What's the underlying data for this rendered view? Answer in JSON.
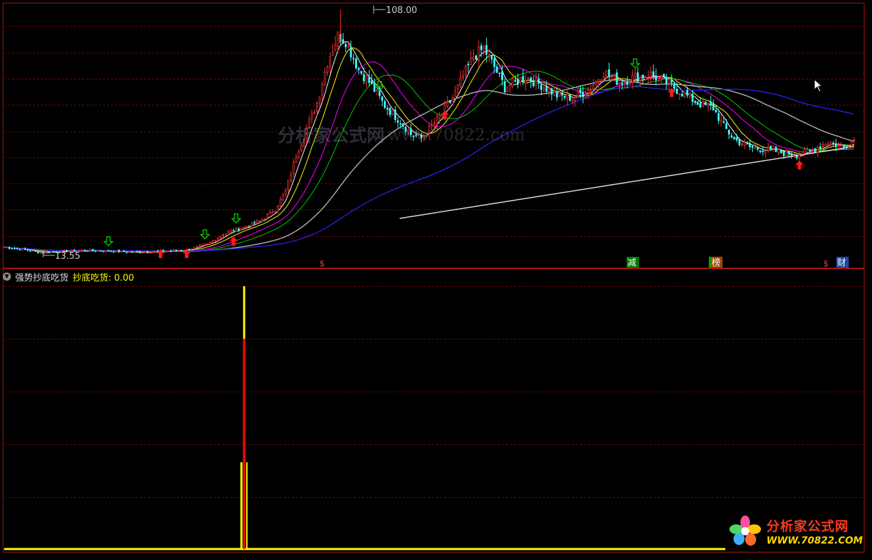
{
  "indicator": {
    "name": "强势抄底吃货",
    "series_label": "抄底吃货:",
    "series_value": "0.00",
    "collapse_icon": "chevron-down-icon"
  },
  "price_panel": {
    "high_label": "108.00",
    "low_label": "13.55",
    "event_markers": [
      "$",
      "减",
      "榜",
      "$",
      "财"
    ]
  },
  "watermarks": {
    "center_cn": "分析家公式网",
    "center_url": "www.70822.com",
    "brand_cn": "分析家公式网",
    "brand_url": "WWW.70822.COM"
  },
  "colors": {
    "background": "#000000",
    "border": "#b01010",
    "grid": "#7a0000",
    "up_candle": "#ff3030",
    "down_candle": "#40ffff",
    "ma5": "#ffffff",
    "ma10": "#ffff00",
    "ma20": "#ff00ff",
    "ma30": "#00cc00",
    "ma60": "#aaaaaa",
    "ma120": "#2020d0",
    "indicator_line": "#ffff00",
    "signal_bar": "#ff0000",
    "buy_arrow": "#ff1a1a",
    "sell_arrow": "#00c000"
  },
  "chart_data": [
    {
      "type": "candlestick",
      "ylim": [
        13.55,
        108.0
      ],
      "max_label": 108.0,
      "min_label": 13.55,
      "anchors": [
        [
          0,
          16.5
        ],
        [
          8,
          15.5
        ],
        [
          14,
          14.3
        ],
        [
          20,
          14.8
        ],
        [
          30,
          15.2
        ],
        [
          40,
          15.0
        ],
        [
          50,
          14.5
        ],
        [
          60,
          14.8
        ],
        [
          70,
          15.5
        ],
        [
          78,
          17.5
        ],
        [
          84,
          21.5
        ],
        [
          90,
          23.5
        ],
        [
          98,
          26.5
        ],
        [
          104,
          31.0
        ],
        [
          108,
          38.0
        ],
        [
          112,
          52.0
        ],
        [
          116,
          62.0
        ],
        [
          120,
          72.0
        ],
        [
          124,
          88.0
        ],
        [
          128,
          98.0
        ],
        [
          131,
          96.0
        ],
        [
          136,
          85.0
        ],
        [
          140,
          80.0
        ],
        [
          146,
          71.0
        ],
        [
          152,
          65.0
        ],
        [
          156,
          60.0
        ],
        [
          160,
          58.5
        ],
        [
          164,
          63.0
        ],
        [
          168,
          68.0
        ],
        [
          172,
          74.0
        ],
        [
          176,
          82.0
        ],
        [
          180,
          90.0
        ],
        [
          184,
          93.0
        ],
        [
          188,
          86.0
        ],
        [
          192,
          78.0
        ],
        [
          196,
          80.0
        ],
        [
          200,
          82.0
        ],
        [
          206,
          79.0
        ],
        [
          212,
          75.0
        ],
        [
          218,
          74.0
        ],
        [
          224,
          77.0
        ],
        [
          230,
          84.0
        ],
        [
          236,
          80.0
        ],
        [
          242,
          82.0
        ],
        [
          248,
          83.0
        ],
        [
          254,
          80.0
        ],
        [
          260,
          76.0
        ],
        [
          266,
          72.0
        ],
        [
          272,
          70.0
        ],
        [
          276,
          63.0
        ],
        [
          280,
          58.0
        ],
        [
          286,
          55.0
        ],
        [
          292,
          54.0
        ],
        [
          298,
          53.0
        ],
        [
          304,
          52.0
        ],
        [
          310,
          54.0
        ],
        [
          316,
          57.0
        ],
        [
          322,
          55.0
        ],
        [
          326,
          58.0
        ]
      ],
      "buy_signals": [
        60,
        70,
        88,
        169,
        256,
        305
      ],
      "sell_signals": [
        40,
        77,
        89,
        144,
        242
      ]
    },
    {
      "type": "line",
      "series": [
        {
          "name": "抄底吃货",
          "values_note": "0 except spike",
          "spike_index": 91,
          "spike_value": 100
        }
      ],
      "ylim": [
        0,
        100
      ]
    }
  ]
}
